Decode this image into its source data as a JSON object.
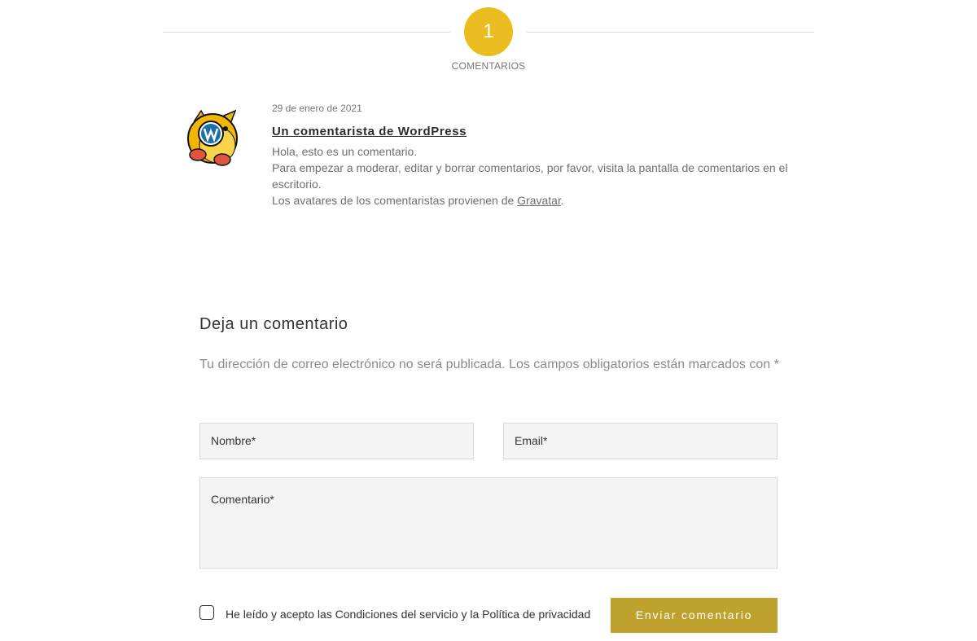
{
  "comments_header": {
    "count": "1",
    "label": "COMENTARIOS",
    "badge_color": "#ecbd21"
  },
  "comment": {
    "avatar_icon": "wapuu-wordpress-mascot-icon",
    "date": "29 de enero de 2021",
    "author": "Un comentarista de WordPress",
    "line1": "Hola, esto es un comentario.",
    "line2": "Para empezar a moderar, editar y borrar comentarios, por favor, visita la pantalla de comentarios en el escritorio.",
    "line3_prefix": "Los avatares de los comentaristas provienen de ",
    "line3_link": "Gravatar",
    "line3_suffix": "."
  },
  "form": {
    "title": "Deja un comentario",
    "note": "Tu dirección de correo electrónico no será publicada. Los campos obligatorios están marcados con *",
    "name_placeholder": "Nombre*",
    "email_placeholder": "Email*",
    "comment_placeholder": "Comentario*",
    "consent_label": "He leído y acepto las Condiciones del servicio y la Política de privacidad",
    "submit_label": "Enviar comentario",
    "submit_color": "#bfa22e"
  }
}
